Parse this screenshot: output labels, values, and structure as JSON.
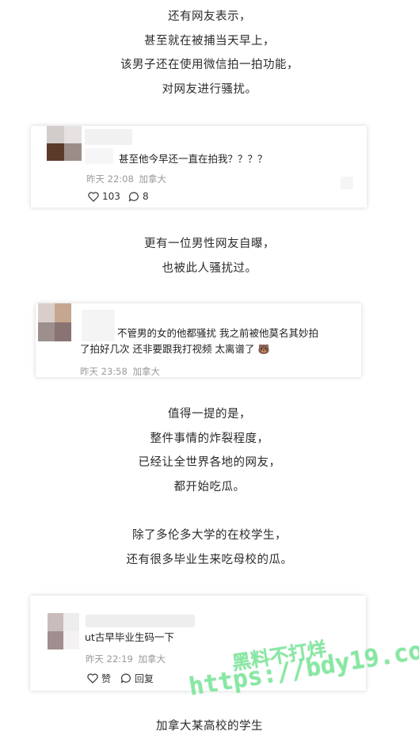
{
  "paragraphs": [
    [
      "还有网友表示，",
      "甚至就在被捕当天早上，",
      "该男子还在使用微信拍一拍功能，",
      "对网友进行骚扰。"
    ],
    [
      "更有一位男性网友自曝，",
      "也被此人骚扰过。"
    ],
    [
      "值得一提的是，",
      "整件事情的炸裂程度，",
      "已经让全世界各地的网友，",
      "都开始吃瓜。"
    ],
    [
      "除了多伦多大学的在校学生，",
      "还有很多毕业生来吃母校的瓜。"
    ],
    [
      "加拿大某高校的学生"
    ]
  ],
  "comments": [
    {
      "text": "甚至他今早还一直在拍我？？？？",
      "time": "昨天 22:08",
      "location": "加拿大",
      "likes": "103",
      "replies": "8"
    },
    {
      "text_line1": "不管男的女的他都骚扰 我之前被他莫名其妙拍",
      "text_line2": "了拍好几次 还非要跟我打视频 太离谱了",
      "emoji": "🐻",
      "time": "昨天 23:58",
      "location": "加拿大"
    },
    {
      "text": "ut古早毕业生码一下",
      "time": "昨天 22:19",
      "location": "加拿大",
      "like_label": "赞",
      "reply_label": "回复"
    }
  ],
  "watermark": {
    "line1": "黑料不打烊",
    "line2": "https://bdy19.co"
  },
  "colors": {
    "watermark": "#8aeba8",
    "meta_text": "#999999"
  }
}
